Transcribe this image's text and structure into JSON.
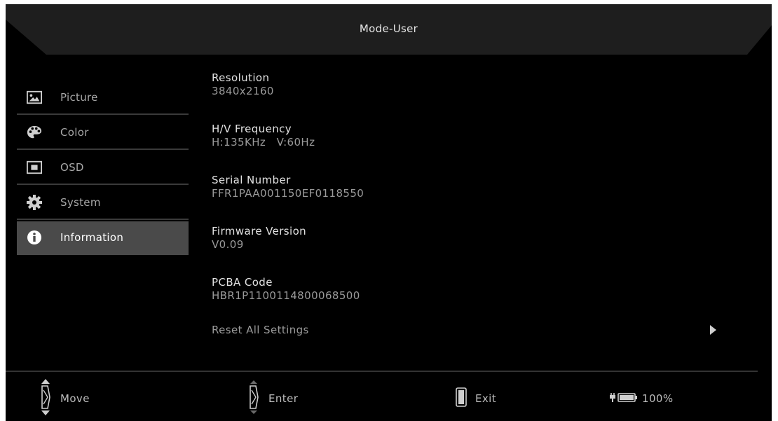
{
  "header": {
    "title": "Mode-User"
  },
  "sidebar": {
    "items": [
      {
        "label": "Picture",
        "icon": "picture-icon",
        "active": false
      },
      {
        "label": "Color",
        "icon": "palette-icon",
        "active": false
      },
      {
        "label": "OSD",
        "icon": "osd-icon",
        "active": false
      },
      {
        "label": "System",
        "icon": "gear-icon",
        "active": false
      },
      {
        "label": "Information",
        "icon": "info-icon",
        "active": true
      }
    ]
  },
  "info": {
    "resolution": {
      "label": "Resolution",
      "value": "3840x2160"
    },
    "frequency": {
      "label": "H/V Frequency",
      "value": "H:135KHz   V:60Hz"
    },
    "serial": {
      "label": "Serial Number",
      "value": "FFR1PAA001150EF0118550"
    },
    "firmware": {
      "label": "Firmware Version",
      "value": "V0.09"
    },
    "pcba": {
      "label": "PCBA Code",
      "value": "HBR1P1100114800068500"
    },
    "reset": {
      "label": "Reset All Settings"
    }
  },
  "footer": {
    "move": "Move",
    "enter": "Enter",
    "exit": "Exit",
    "power": "100%"
  },
  "colors": {
    "background": "#000000",
    "header": "#1e1e1e",
    "active_item": "#4a4a4a"
  }
}
